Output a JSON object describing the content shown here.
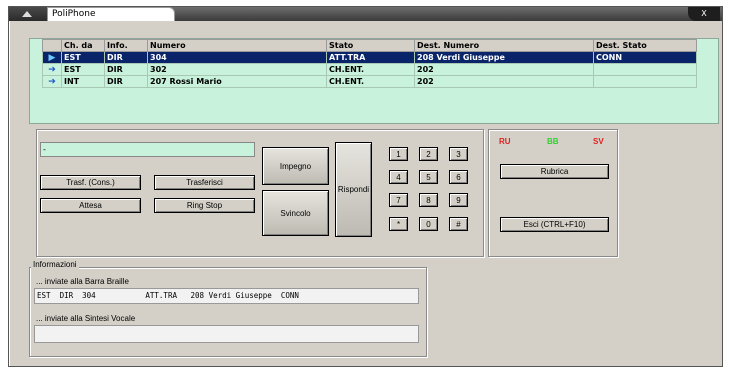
{
  "window": {
    "title": "PoliPhone",
    "close_label": "X"
  },
  "calls_table": {
    "columns": [
      "Ch. da",
      "Info.",
      "Numero",
      "Stato",
      "Dest. Numero",
      "Dest. Stato"
    ],
    "rows": [
      {
        "selected": true,
        "arrow": "▶",
        "cells": [
          "EST",
          "DIR",
          "304",
          "ATT.TRA",
          "208 Verdi Giuseppe",
          "CONN"
        ]
      },
      {
        "selected": false,
        "arrow": "➔",
        "cells": [
          "EST",
          "DIR",
          "302",
          "CH.ENT.",
          "202",
          ""
        ]
      },
      {
        "selected": false,
        "arrow": "➔",
        "cells": [
          "INT",
          "DIR",
          "207 Rossi Mario",
          "CH.ENT.",
          "202",
          ""
        ]
      }
    ]
  },
  "controls": {
    "number_input_value": "-",
    "trasf_cons": "Trasf. (Cons.)",
    "trasferisci": "Trasferisci",
    "attesa": "Attesa",
    "ring_stop": "Ring Stop",
    "impegno": "Impegno",
    "svincolo": "Svincolo",
    "rispondi": "Rispondi",
    "keypad": [
      "1",
      "2",
      "3",
      "4",
      "5",
      "6",
      "7",
      "8",
      "9",
      "*",
      "0",
      "#"
    ]
  },
  "side_panel": {
    "indicators": [
      {
        "label": "RU",
        "color": "#e02020"
      },
      {
        "label": "BB",
        "color": "#30d030"
      },
      {
        "label": "SV",
        "color": "#e02020"
      }
    ],
    "rubrica": "Rubrica",
    "esci": "Esci (CTRL+F10)"
  },
  "info": {
    "legend": "Informazioni",
    "braille_label": "... inviate alla Barra Braille",
    "braille_text": "EST  DIR  304           ATT.TRA   208 Verdi Giuseppe  CONN",
    "voice_label": "... inviate alla Sintesi Vocale",
    "voice_text": ""
  }
}
